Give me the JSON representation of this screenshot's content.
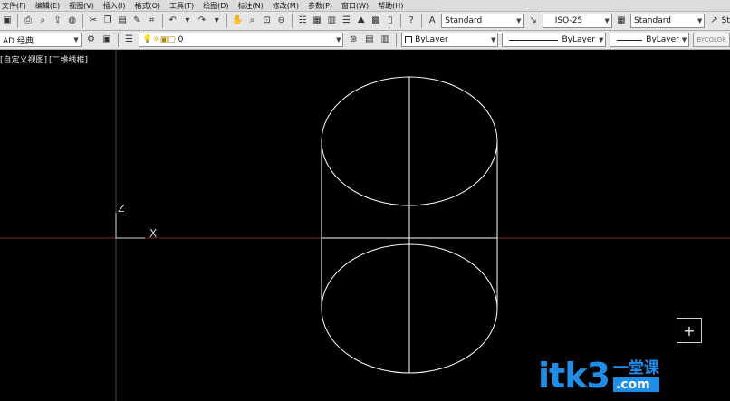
{
  "menu": [
    "文件(F)",
    "编辑(E)",
    "视图(V)",
    "插入(I)",
    "格式(O)",
    "工具(T)",
    "绘图(D)",
    "标注(N)",
    "修改(M)",
    "参数(P)",
    "窗口(W)",
    "帮助(H)"
  ],
  "toolbar1": {
    "text_style": "Standard",
    "dim_style": "ISO-25",
    "table_style": "Standard",
    "overflow_label": "St"
  },
  "toolbar2": {
    "workspace": "AD 经典",
    "layer": "0",
    "color": "ByLayer",
    "linetype": "ByLayer",
    "lineweight": "ByLayer",
    "plot_style": "BYCOLOR"
  },
  "viewport": {
    "view_name": "[自定义视图]",
    "visual_style": "[二维线框]",
    "ucs_z_label": "Z",
    "ucs_x_label": "X",
    "nav_plus": "+"
  },
  "watermark": {
    "main": "itk3",
    "cn": "一堂课",
    "com": ".com"
  },
  "colors": {
    "wireframe": "#ffffff",
    "x_axis_line": "#7a2a2a",
    "y_axis_line": "#2f5a35",
    "watermark_blue": "#1f8ee8"
  }
}
